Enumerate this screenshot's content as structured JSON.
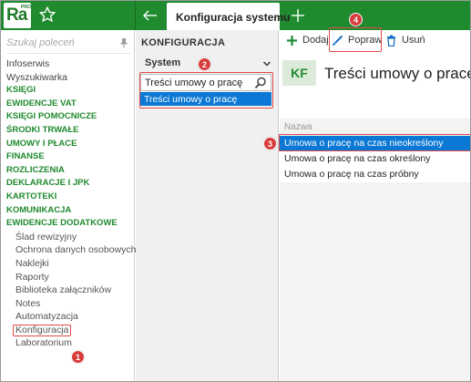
{
  "app": {
    "logo_text": "Ra",
    "logo_sub": "PRO",
    "active_tab": "Konfiguracja systemu"
  },
  "sidebar": {
    "search_placeholder": "Szukaj poleceń",
    "items": [
      {
        "label": "Infoserwis",
        "kind": "plain"
      },
      {
        "label": "Wyszukiwarka",
        "kind": "plain"
      },
      {
        "label": "KSIĘGI",
        "kind": "section"
      },
      {
        "label": "EWIDENCJE VAT",
        "kind": "section"
      },
      {
        "label": "KSIĘGI POMOCNICZE",
        "kind": "section"
      },
      {
        "label": "ŚRODKI TRWAŁE",
        "kind": "section"
      },
      {
        "label": "UMOWY I PŁACE",
        "kind": "section"
      },
      {
        "label": "FINANSE",
        "kind": "section"
      },
      {
        "label": "ROZLICZENIA",
        "kind": "section"
      },
      {
        "label": "DEKLARACJE I JPK",
        "kind": "section"
      },
      {
        "label": "KARTOTEKI",
        "kind": "section"
      },
      {
        "label": "KOMUNIKACJA",
        "kind": "section"
      },
      {
        "label": "EWIDENCJE DODATKOWE",
        "kind": "section"
      },
      {
        "label": "Ślad rewizyjny",
        "kind": "sub"
      },
      {
        "label": "Ochrona danych osobowych",
        "kind": "sub"
      },
      {
        "label": "Naklejki",
        "kind": "sub"
      },
      {
        "label": "Raporty",
        "kind": "sub"
      },
      {
        "label": "Biblioteka załączników",
        "kind": "sub"
      },
      {
        "label": "Notes",
        "kind": "sub"
      },
      {
        "label": "Automatyzacja",
        "kind": "sub"
      },
      {
        "label": "Konfiguracja",
        "kind": "sub",
        "selected": true
      },
      {
        "label": "Laboratorium",
        "kind": "sub"
      }
    ]
  },
  "config_panel": {
    "title": "KONFIGURACJA",
    "group_select": "System",
    "search_value": "Treści umowy o pracę",
    "result": "Treści umowy o pracę"
  },
  "toolbar": {
    "add_label": "Dodaj",
    "edit_label": "Popraw",
    "delete_label": "Usuń"
  },
  "content": {
    "badge": "KF",
    "title": "Treści umowy o pracę",
    "column_header": "Nazwa",
    "rows": [
      {
        "name": "Umowa o pracę na czas nieokreślony",
        "selected": true
      },
      {
        "name": "Umowa o pracę na czas określony",
        "selected": false
      },
      {
        "name": "Umowa o pracę na czas próbny",
        "selected": false
      }
    ]
  },
  "steps": {
    "s1": "1",
    "s2": "2",
    "s3": "3",
    "s4": "4"
  },
  "colors": {
    "brand_green": "#1f8a2e",
    "selection_blue": "#0a78d4",
    "annotation_red": "#d83b3b"
  }
}
